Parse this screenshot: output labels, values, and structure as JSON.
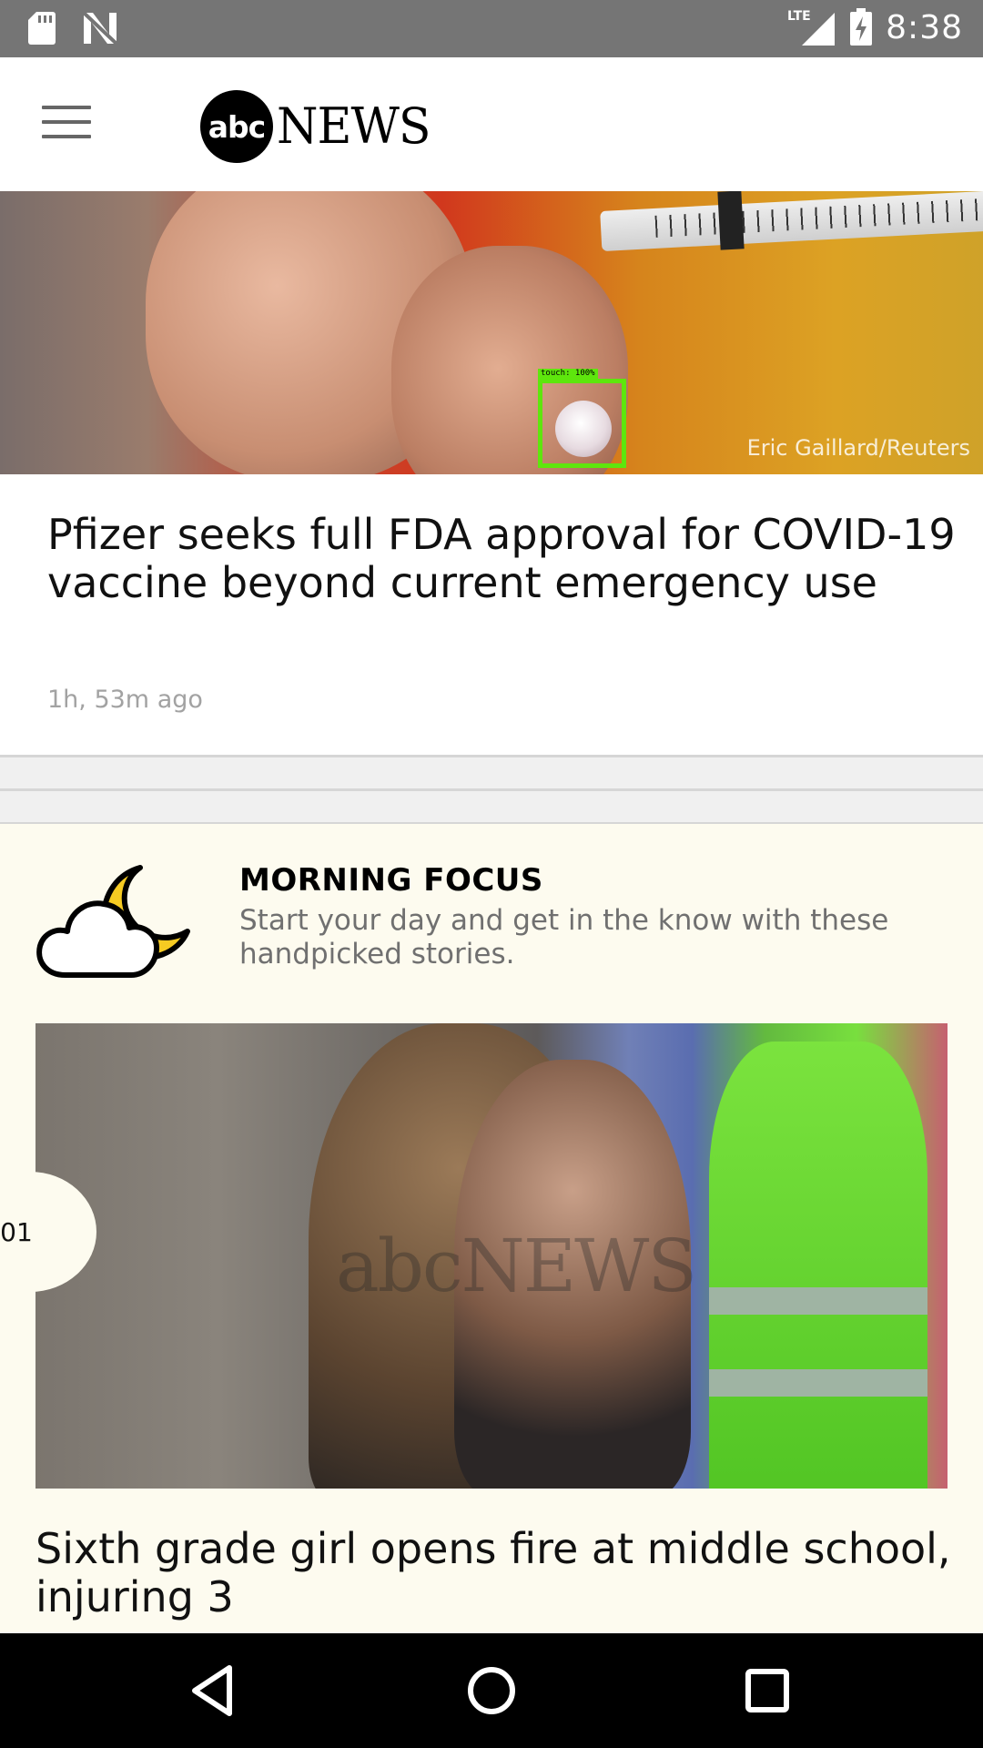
{
  "status_bar": {
    "time": "8:38",
    "network": "LTE",
    "icons_left": [
      "sd-card-icon",
      "n-notification-icon"
    ],
    "icons_right": [
      "lte-signal-icon",
      "battery-charging-icon"
    ]
  },
  "app_bar": {
    "menu_icon": "hamburger-menu-icon",
    "logo_badge": "abc",
    "logo_word": "NEWS"
  },
  "top_story": {
    "photo_credit": "Eric Gaillard/Reuters",
    "title": "Pfizer seeks full FDA approval for COVID-19 vaccine beyond current emergency use",
    "time_ago": "1h, 53m ago",
    "touch_label": "touch: 100%"
  },
  "morning_focus": {
    "icon": "moon-cloud-icon",
    "title": "MORNING FOCUS",
    "subtitle": "Start your day and get in the know with these handpicked stories.",
    "items": [
      {
        "number": "01",
        "title": "Sixth grade girl opens fire at middle school, injuring 3",
        "watermark": "abcNEWS"
      }
    ]
  },
  "nav_bar": {
    "back": "back-icon",
    "home": "home-icon",
    "recents": "recents-icon"
  }
}
